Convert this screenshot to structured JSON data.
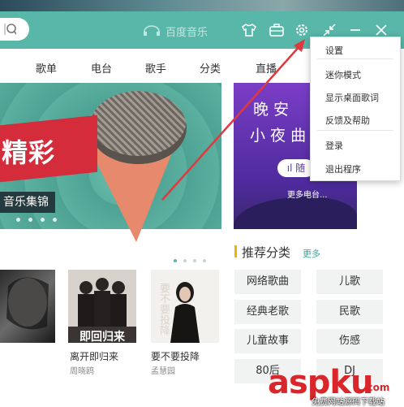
{
  "app": {
    "brand": "百度音乐"
  },
  "nav": {
    "items": [
      "歌单",
      "电台",
      "歌手",
      "分类",
      "直播"
    ]
  },
  "banner": {
    "title": "精彩",
    "subtitle": "音乐集锦"
  },
  "night_card": {
    "line1": "晚 安",
    "line2": "小 夜 曲",
    "button": "ıl 随",
    "more": "更多电台..."
  },
  "recommend": {
    "title": "推荐分类",
    "more": "更多",
    "categories": [
      "网络歌曲",
      "儿歌",
      "经典老歌",
      "民歌",
      "儿童故事",
      "伤感",
      "80后",
      "DJ"
    ]
  },
  "albums": [
    {
      "title": "离开即归来",
      "artist": "周晓鸥",
      "cover_text": "即回归来"
    },
    {
      "title": "要不要投降",
      "artist": "孟慧园",
      "cover_text": "要不要投降"
    }
  ],
  "menu": {
    "items": [
      "设置",
      "迷你模式",
      "显示桌面歌词",
      "反馈及帮助",
      "登录",
      "退出程序"
    ]
  },
  "watermark": {
    "main": "aspku",
    "suffix": ".com",
    "sub": "免费网站源码下载站"
  },
  "colors": {
    "accent": "#58b7a8",
    "highlight": "#f2b300",
    "arrow": "#e0383f"
  }
}
